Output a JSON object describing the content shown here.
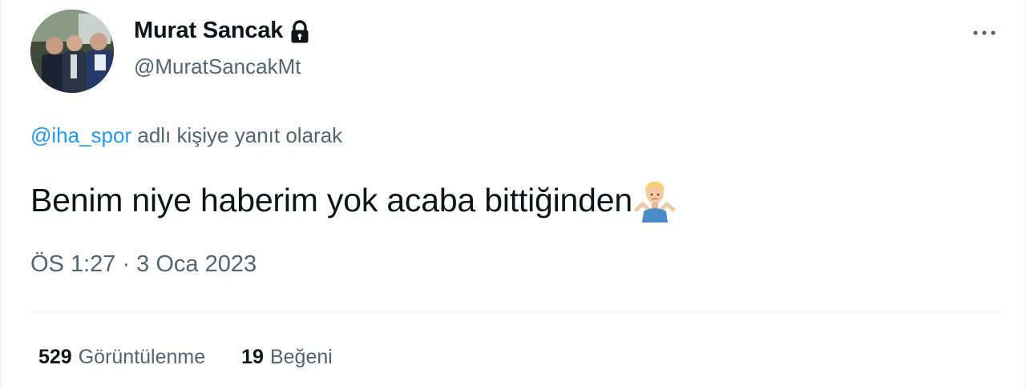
{
  "user": {
    "display_name": "Murat Sancak",
    "handle": "@MuratSancakMt",
    "protected_icon": "lock-icon",
    "avatar_icon": "profile-photo"
  },
  "more_icon": "more-horizontal-icon",
  "reply": {
    "mention": "@iha_spor",
    "suffix": " adlı kişiye yanıt olarak"
  },
  "tweet": {
    "text": "Benim niye haberim yok acaba bittiğinden",
    "emoji": "man-shrugging-emoji",
    "timestamp": "ÖS 1:27 · 3 Oca 2023"
  },
  "stats": {
    "views_count": "529",
    "views_label": "Görüntülenme",
    "likes_count": "19",
    "likes_label": "Beğeni"
  },
  "colors": {
    "text_primary": "#0f1419",
    "text_secondary": "#536471",
    "link": "#1d9bf0",
    "divider": "#eff3f4"
  }
}
